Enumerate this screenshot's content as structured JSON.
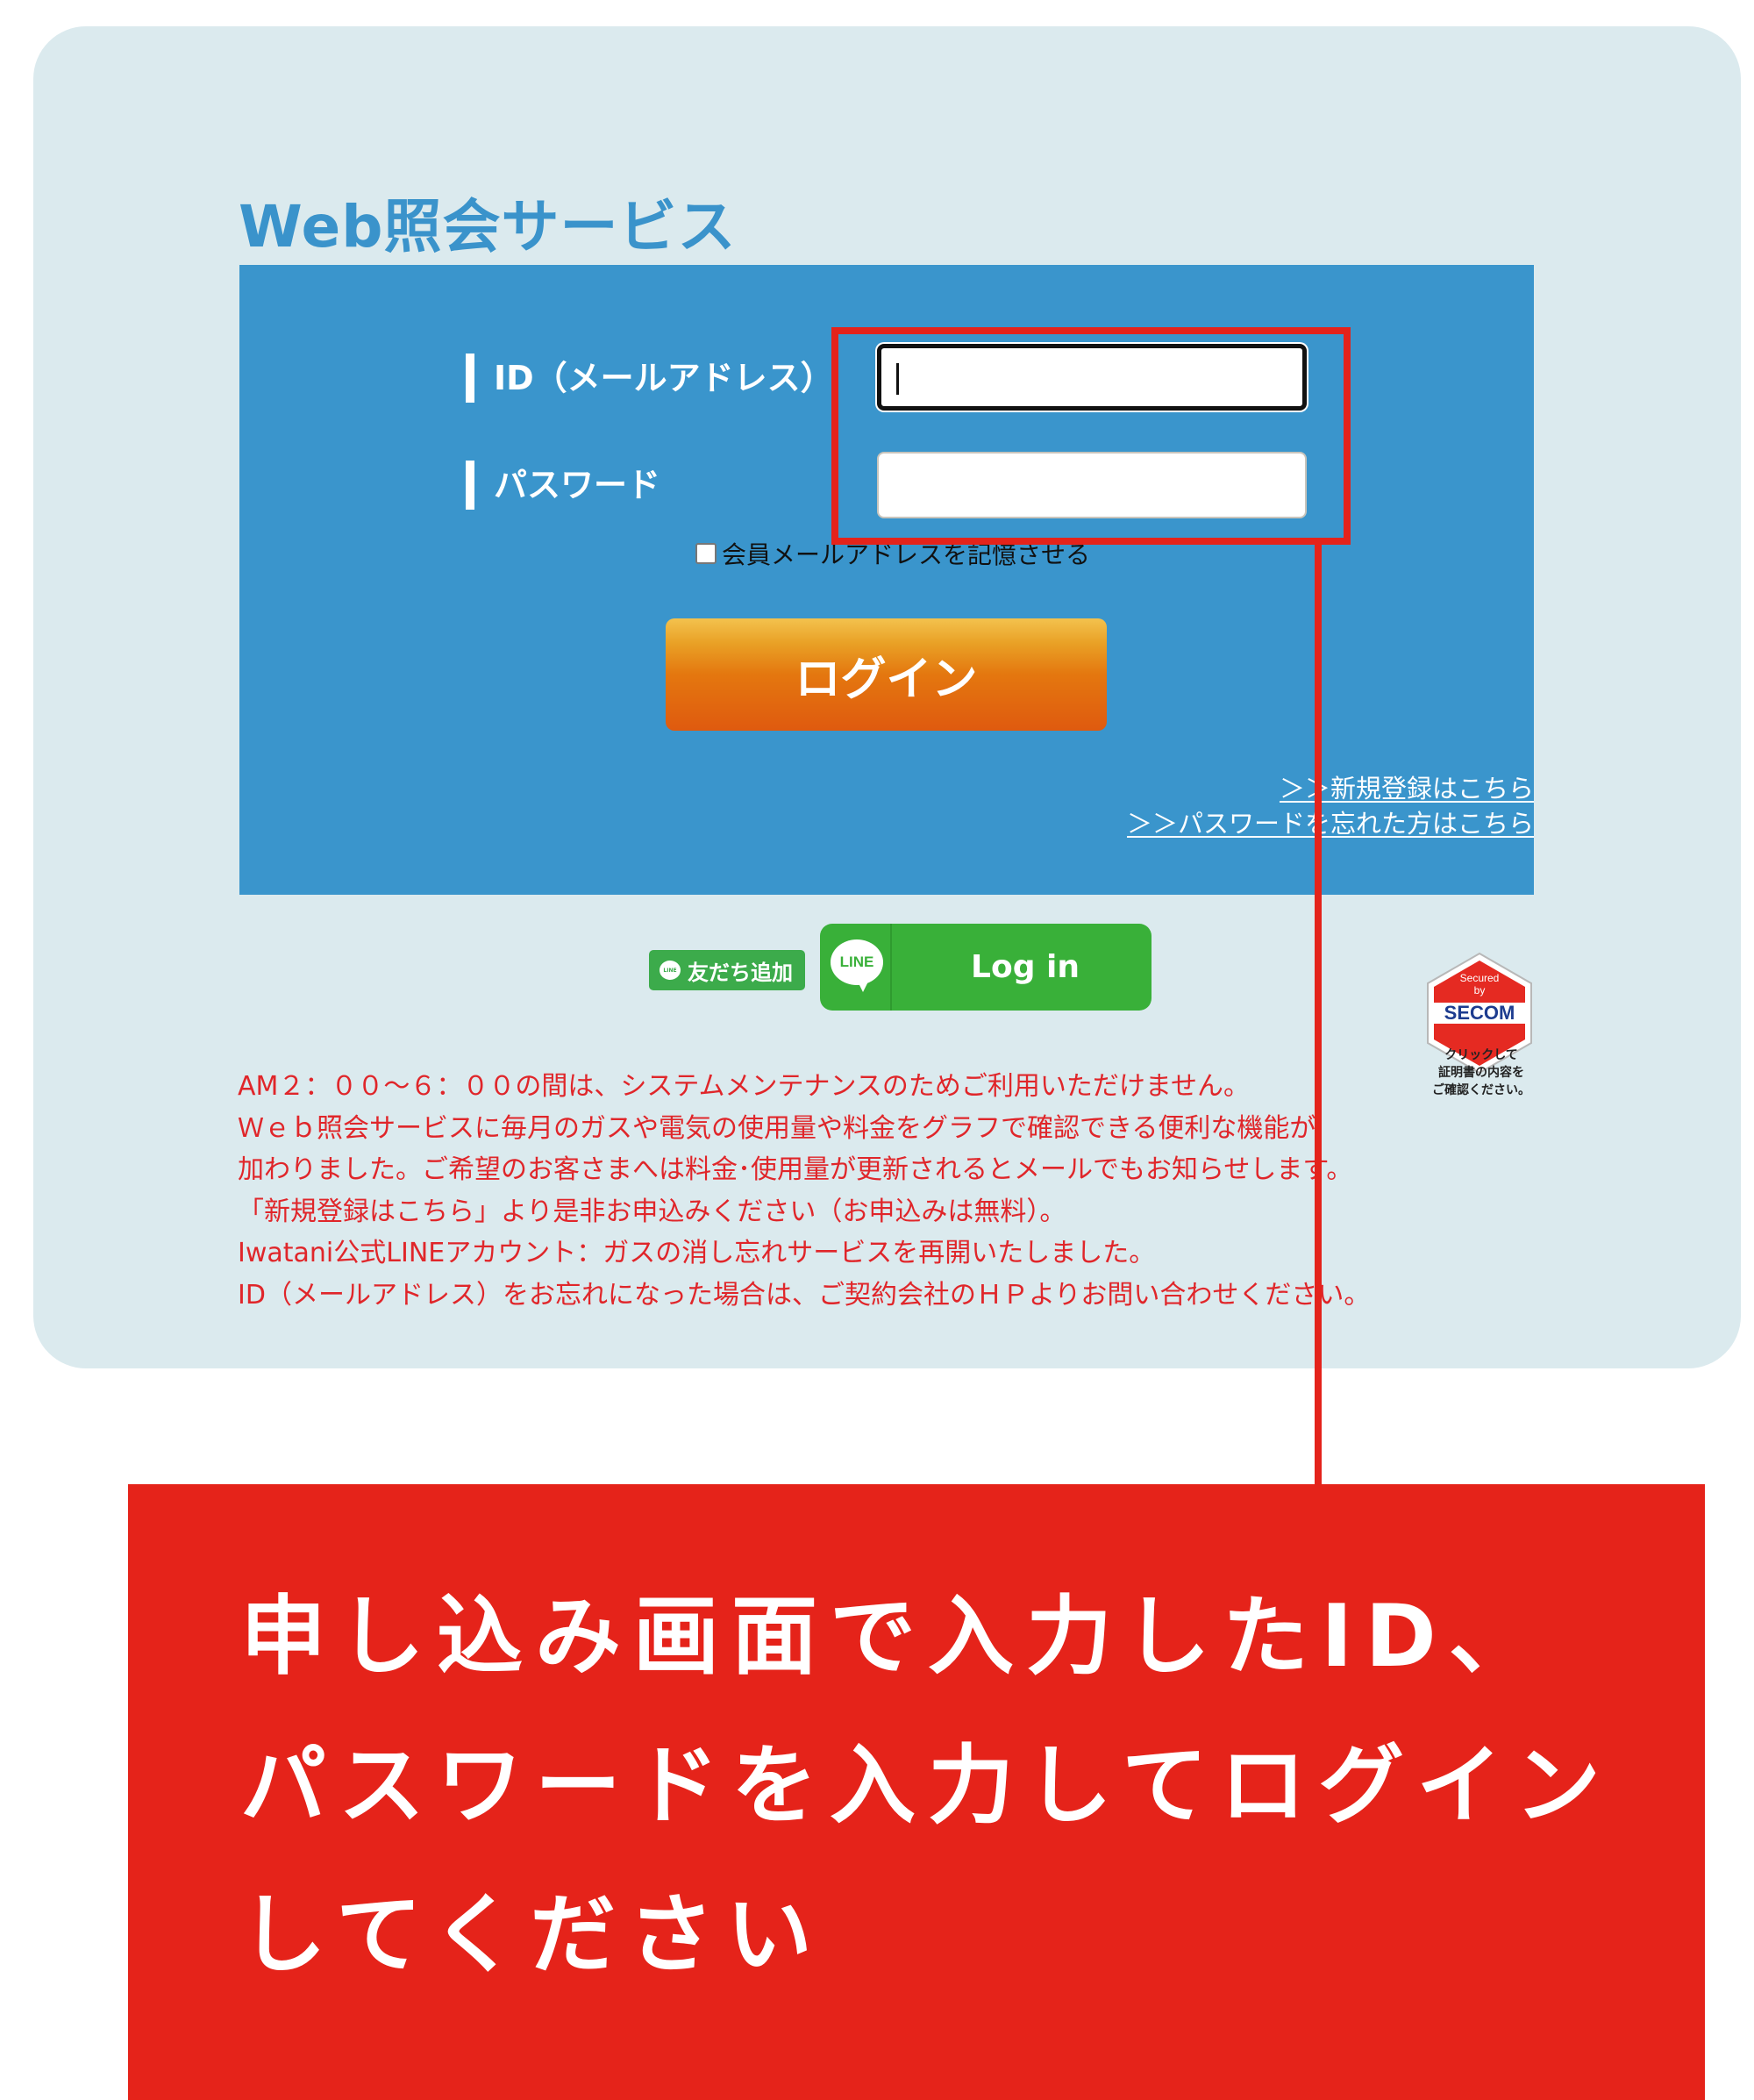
{
  "page": {
    "title": "Web照会サービス"
  },
  "login_form": {
    "id_label": "ID（メールアドレス）",
    "id_value": "",
    "password_label": "パスワード",
    "password_value": "",
    "remember_label": "会員メールアドレスを記憶させる",
    "remember_checked": false,
    "login_button": "ログイン",
    "register_link": "＞＞新規登録はこちら",
    "forgot_link": "＞＞パスワードを忘れた方はこちら"
  },
  "line": {
    "add_friend_label": "友だち追加",
    "add_friend_icon": "line-bubble-icon",
    "logo_text": "LINE",
    "login_label": "Log in"
  },
  "secom": {
    "badge_top": "Secured by",
    "badge_brand": "SECOM",
    "caption": [
      "クリックして",
      "証明書の内容を",
      "ご確認ください。"
    ]
  },
  "notices": [
    "AM２：００～６：００の間は、システムメンテナンスのためご利用いただけません。",
    "Ｗｅｂ照会サービスに毎月のガスや電気の使用量や料金をグラフで確認できる便利な機能が",
    "加わりました。ご希望のお客さまへは料金･使用量が更新されるとメールでもお知らせします。",
    "「新規登録はこちら」より是非お申込みください（お申込みは無料）。",
    "Iwatani公式LINEアカウント：ガスの消し忘れサービスを再開いたしました。",
    "ID（メールアドレス）をお忘れになった場合は、ご契約会社のＨＰよりお問い合わせください。"
  ],
  "callout": {
    "lines": [
      "申し込み画面で入力したID、",
      "パスワードを入力してログイン",
      "してください"
    ]
  },
  "colors": {
    "card_bg": "#dbeaee",
    "panel_blue": "#3a95cc",
    "title_blue": "#3a93cb",
    "accent_red": "#e5231a",
    "notice_red": "#e0262a",
    "line_green": "#39b039",
    "login_orange": "#e4770f"
  }
}
